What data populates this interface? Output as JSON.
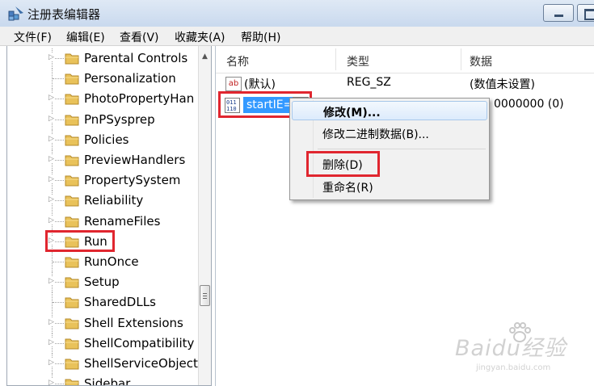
{
  "window": {
    "title": "注册表编辑器"
  },
  "menu": [
    "文件(F)",
    "编辑(E)",
    "查看(V)",
    "收藏夹(A)",
    "帮助(H)"
  ],
  "tree": {
    "items": [
      {
        "label": "Parental Controls",
        "expandable": true
      },
      {
        "label": "Personalization",
        "expandable": false
      },
      {
        "label": "PhotoPropertyHan",
        "expandable": true
      },
      {
        "label": "PnPSysprep",
        "expandable": true
      },
      {
        "label": "Policies",
        "expandable": true
      },
      {
        "label": "PreviewHandlers",
        "expandable": true
      },
      {
        "label": "PropertySystem",
        "expandable": true
      },
      {
        "label": "Reliability",
        "expandable": true
      },
      {
        "label": "RenameFiles",
        "expandable": true
      },
      {
        "label": "Run",
        "expandable": true,
        "highlighted": true
      },
      {
        "label": "RunOnce",
        "expandable": false
      },
      {
        "label": "Setup",
        "expandable": true
      },
      {
        "label": "SharedDLLs",
        "expandable": false
      },
      {
        "label": "Shell Extensions",
        "expandable": true
      },
      {
        "label": "ShellCompatibility",
        "expandable": true
      },
      {
        "label": "ShellServiceObjectI",
        "expandable": true
      },
      {
        "label": "Sidebar",
        "expandable": true
      }
    ]
  },
  "values": {
    "columns": [
      "名称",
      "类型",
      "数据"
    ],
    "rows": [
      {
        "name": "(默认)",
        "type": "REG_SZ",
        "data": "(数值未设置)",
        "icon": "string-value-icon"
      },
      {
        "name": "startIE=",
        "type": "",
        "data": "0000000 (0)",
        "icon": "binary-value-icon",
        "selected": true
      }
    ]
  },
  "context_menu": {
    "items": [
      {
        "label": "修改(M)...",
        "bold": true
      },
      {
        "label": "修改二进制数据(B)..."
      },
      {
        "label": "删除(D)",
        "highlighted": true
      },
      {
        "label": "重命名(R)"
      }
    ]
  },
  "watermark": {
    "main": "Baidu经验",
    "sub": "jingyan.baidu.com"
  }
}
